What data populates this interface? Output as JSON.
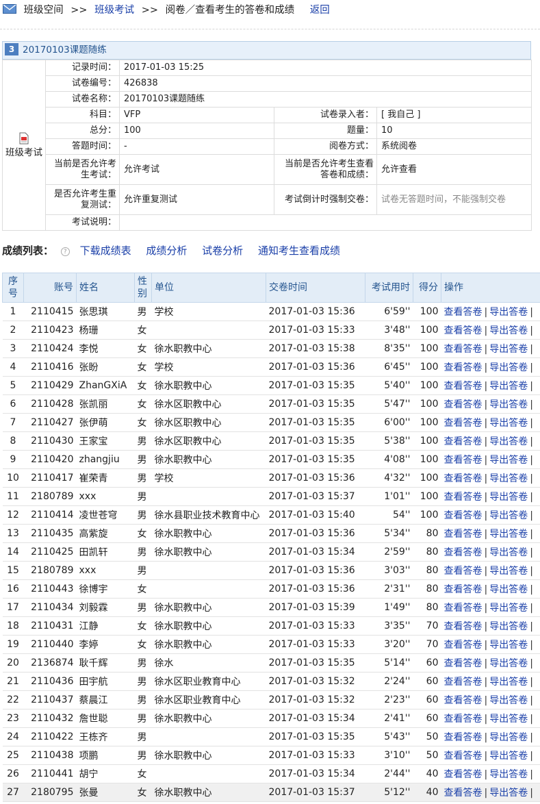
{
  "breadcrumb": {
    "home": "班级空间",
    "sep": ">>",
    "exam": "班级考试",
    "current": "阅卷／查看考生的答卷和成绩",
    "back": "返回"
  },
  "exam": {
    "index": "3",
    "title": "20170103课题随练",
    "side_label": "班级考试",
    "labels": {
      "record_time": "记录时间：",
      "paper_no": "试卷编号：",
      "paper_name": "试卷名称：",
      "subject": "科目：",
      "entered_by": "试卷录入者：",
      "total": "总分：",
      "count": "题量：",
      "duration": "答题时间：",
      "grading": "阅卷方式：",
      "allow_exam": "当前是否允许考生考试：",
      "allow_view": "当前是否允许考生查看答卷和成绩：",
      "allow_retest": "是否允许考生重复测试：",
      "countdown": "考试倒计时强制交卷：",
      "description": "考试说明："
    },
    "values": {
      "record_time": "2017-01-03 15:25",
      "paper_no": "426838",
      "paper_name": "20170103课题随练",
      "subject": "VFP",
      "entered_by": "[ 我自己 ]",
      "total": "100",
      "count": "10",
      "duration": "-",
      "grading": "系统阅卷",
      "allow_exam": "允许考试",
      "allow_view": "允许查看",
      "allow_retest": "允许重复测试",
      "countdown": "试卷无答题时间，不能强制交卷",
      "description": ""
    }
  },
  "scores": {
    "label": "成绩列表：",
    "help_glyph": "?",
    "actions": [
      "下载成绩表",
      "成绩分析",
      "试卷分析",
      "通知考生查看成绩"
    ]
  },
  "table": {
    "headers": [
      "序号",
      "账号",
      "姓名",
      "性别",
      "单位",
      "交卷时间",
      "考试用时",
      "得分",
      "操作"
    ],
    "view_label": "查看答卷",
    "export_label": "导出答卷",
    "rows": [
      [
        "1",
        "2110415",
        "张思琪",
        "男",
        "学校",
        "2017-01-03 15:36",
        "6'59''",
        "100"
      ],
      [
        "2",
        "2110423",
        "杨珊",
        "女",
        "",
        "2017-01-03 15:33",
        "3'48''",
        "100"
      ],
      [
        "3",
        "2110424",
        "李悦",
        "女",
        "徐水职教中心",
        "2017-01-03 15:38",
        "8'35''",
        "100"
      ],
      [
        "4",
        "2110416",
        "张盼",
        "女",
        "学校",
        "2017-01-03 15:36",
        "6'45''",
        "100"
      ],
      [
        "5",
        "2110429",
        "ZhanGXiA",
        "女",
        "徐水职教中心",
        "2017-01-03 15:35",
        "5'40''",
        "100"
      ],
      [
        "6",
        "2110428",
        "张凯丽",
        "女",
        "徐水区职教中心",
        "2017-01-03 15:35",
        "5'47''",
        "100"
      ],
      [
        "7",
        "2110427",
        "张伊萌",
        "女",
        "徐水区职教中心",
        "2017-01-03 15:35",
        "6'00''",
        "100"
      ],
      [
        "8",
        "2110430",
        "王家宝",
        "男",
        "徐水区职教中心",
        "2017-01-03 15:35",
        "5'38''",
        "100"
      ],
      [
        "9",
        "2110420",
        "zhangjiu",
        "男",
        "徐水职教中心",
        "2017-01-03 15:35",
        "4'08''",
        "100"
      ],
      [
        "10",
        "2110417",
        "崔荣青",
        "男",
        "学校",
        "2017-01-03 15:36",
        "4'32''",
        "100"
      ],
      [
        "11",
        "2180789",
        "xxx",
        "男",
        "",
        "2017-01-03 15:37",
        "1'01''",
        "100"
      ],
      [
        "12",
        "2110414",
        "凌世苍穹",
        "男",
        "徐水县职业技术教育中心",
        "2017-01-03 15:40",
        "54''",
        "100"
      ],
      [
        "13",
        "2110435",
        "高紫旋",
        "女",
        "徐水职教中心",
        "2017-01-03 15:36",
        "5'34''",
        "80"
      ],
      [
        "14",
        "2110425",
        "田凯轩",
        "男",
        "徐水职教中心",
        "2017-01-03 15:34",
        "2'59''",
        "80"
      ],
      [
        "15",
        "2180789",
        "xxx",
        "男",
        "",
        "2017-01-03 15:36",
        "3'03''",
        "80"
      ],
      [
        "16",
        "2110443",
        "徐博宇",
        "女",
        "",
        "2017-01-03 15:36",
        "2'31''",
        "80"
      ],
      [
        "17",
        "2110434",
        "刘毅霖",
        "男",
        "徐水职教中心",
        "2017-01-03 15:39",
        "1'49''",
        "80"
      ],
      [
        "18",
        "2110431",
        "江静",
        "女",
        "徐水职教中心",
        "2017-01-03 15:33",
        "3'35''",
        "70"
      ],
      [
        "19",
        "2110440",
        "李婷",
        "女",
        "徐水职教中心",
        "2017-01-03 15:33",
        "3'20''",
        "70"
      ],
      [
        "20",
        "2136874",
        "耿千辉",
        "男",
        "徐水",
        "2017-01-03 15:35",
        "5'14''",
        "60"
      ],
      [
        "21",
        "2110436",
        "田宇航",
        "男",
        "徐水区职业教育中心",
        "2017-01-03 15:32",
        "2'24''",
        "60"
      ],
      [
        "22",
        "2110437",
        "蔡晨江",
        "男",
        "徐水区职业教育中心",
        "2017-01-03 15:32",
        "2'23''",
        "60"
      ],
      [
        "23",
        "2110432",
        "詹世聪",
        "男",
        "徐水职教中心",
        "2017-01-03 15:34",
        "2'41''",
        "60"
      ],
      [
        "24",
        "2110422",
        "王栋齐",
        "男",
        "",
        "2017-01-03 15:35",
        "5'43''",
        "50"
      ],
      [
        "25",
        "2110438",
        "项鹏",
        "男",
        "徐水职教中心",
        "2017-01-03 15:33",
        "3'10''",
        "50"
      ],
      [
        "26",
        "2110441",
        "胡宁",
        "女",
        "",
        "2017-01-03 15:34",
        "2'44''",
        "40"
      ],
      [
        "27",
        "2180795",
        "张曼",
        "女",
        "徐水职教中心",
        "2017-01-03 15:37",
        "5'12''",
        "40"
      ]
    ],
    "highlight_row": 27
  },
  "colors": {
    "link": "#1a3fa8",
    "header_bg": "#e3edf7",
    "box_head_bg": "#e7f0fa",
    "badge": "#4d7fc0"
  },
  "icons": {
    "breadcrumb": "mail-icon",
    "side": "paper-icon",
    "help": "help-icon"
  }
}
